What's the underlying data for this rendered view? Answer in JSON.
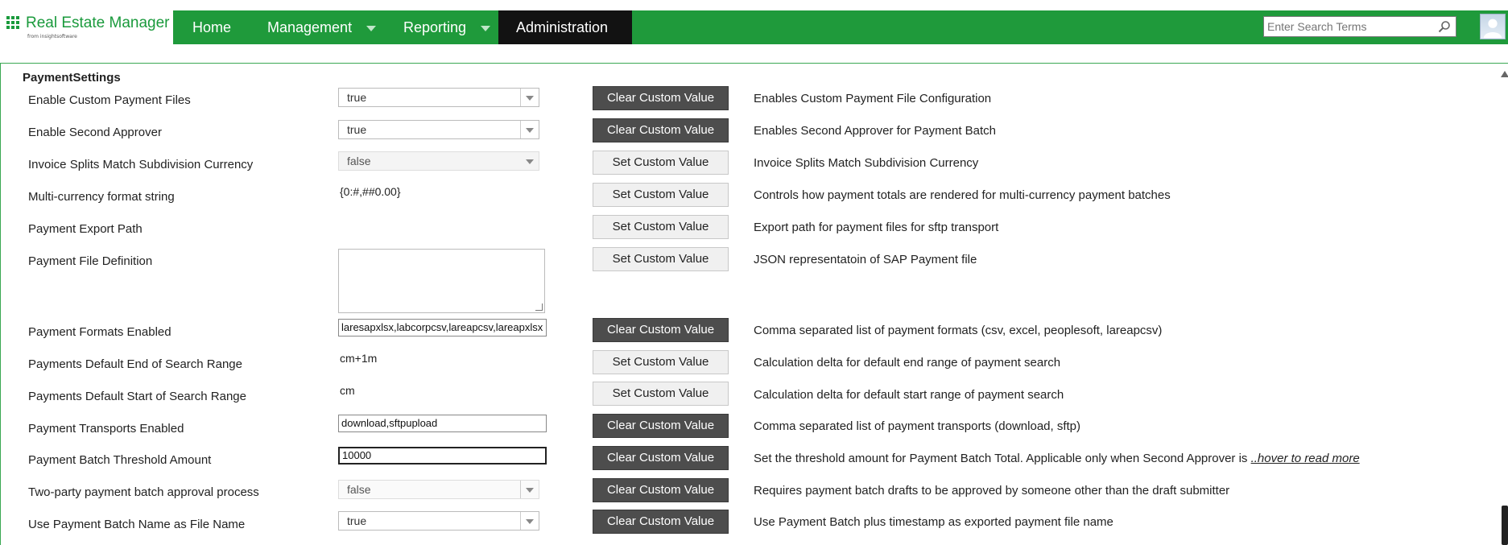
{
  "header": {
    "logo_title": "Real Estate Manager",
    "logo_subtitle": "from insightsoftware",
    "nav": [
      {
        "label": "Home",
        "has_dropdown": false,
        "active": false
      },
      {
        "label": "Management",
        "has_dropdown": true,
        "active": false
      },
      {
        "label": "Reporting",
        "has_dropdown": true,
        "active": false
      },
      {
        "label": "Administration",
        "has_dropdown": false,
        "active": true
      }
    ],
    "search_placeholder": "Enter Search Terms",
    "colors": {
      "nav_bg": "#1f9a3b",
      "nav_active_bg": "#121212",
      "logo": "#1a9a3c"
    }
  },
  "section": {
    "title": "PaymentSettings",
    "rows": [
      {
        "label": "Enable Custom Payment Files",
        "control": "select",
        "value": "true",
        "button": "Clear Custom Value",
        "description": "Enables Custom Payment File Configuration"
      },
      {
        "label": "Enable Second Approver",
        "control": "select",
        "value": "true",
        "button": "Clear Custom Value",
        "description": "Enables Second Approver for Payment Batch"
      },
      {
        "label": "Invoice Splits Match Subdivision Currency",
        "control": "select-disabled",
        "value": "false",
        "button": "Set Custom Value",
        "description": "Invoice Splits Match Subdivision Currency"
      },
      {
        "label": "Multi-currency format string",
        "control": "static",
        "value": "{0:#,##0.00}",
        "button": "Set Custom Value",
        "description": "Controls how payment totals are rendered for multi-currency payment batches"
      },
      {
        "label": "Payment Export Path",
        "control": "none",
        "value": "",
        "button": "Set Custom Value",
        "description": "Export path for payment files for sftp transport"
      },
      {
        "label": "Payment File Definition",
        "control": "textarea",
        "value": "",
        "button": "Set Custom Value",
        "description": "JSON representatoin of SAP Payment file"
      },
      {
        "label": "Payment Formats Enabled",
        "control": "text",
        "value": "laresapxlsx,labcorpcsv,lareapcsv,lareapxlsx",
        "button": "Clear Custom Value",
        "description": "Comma separated list of payment formats (csv, excel, peoplesoft, lareapcsv)"
      },
      {
        "label": "Payments Default End of Search Range",
        "control": "static",
        "value": "cm+1m",
        "button": "Set Custom Value",
        "description": "Calculation delta for default end range of payment search"
      },
      {
        "label": "Payments Default Start of Search Range",
        "control": "static",
        "value": "cm",
        "button": "Set Custom Value",
        "description": "Calculation delta for default start range of payment search"
      },
      {
        "label": "Payment Transports Enabled",
        "control": "text",
        "value": "download,sftpupload",
        "button": "Clear Custom Value",
        "description": "Comma separated list of payment transports (download, sftp)"
      },
      {
        "label": "Payment Batch Threshold Amount",
        "control": "text-focused",
        "value": "10000",
        "button": "Clear Custom Value",
        "description": "Set the threshold amount for Payment Batch Total. Applicable only when Second Approver is ",
        "link": "..hover to read more"
      },
      {
        "label": "Two-party payment batch approval process",
        "control": "select",
        "value": "false",
        "button": "Clear Custom Value",
        "description": "Requires payment batch drafts to be approved by someone other than the draft submitter"
      },
      {
        "label": "Use Payment Batch Name as File Name",
        "control": "select",
        "value": "true",
        "button": "Clear Custom Value",
        "description": "Use Payment Batch plus timestamp as exported payment file name"
      }
    ]
  }
}
